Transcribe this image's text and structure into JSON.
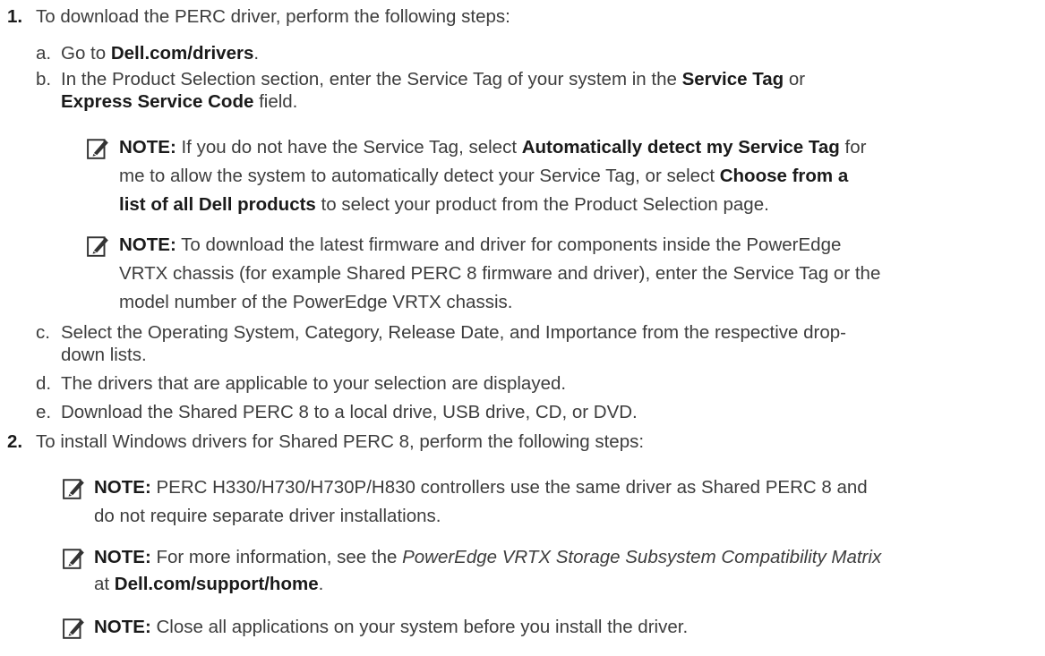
{
  "step1": {
    "number": "1.",
    "intro": "To download the PERC driver, perform the following steps:",
    "a": {
      "letter": "a.",
      "pre": "Go to ",
      "bold": "Dell.com/drivers",
      "post": "."
    },
    "b": {
      "letter": "b.",
      "line1_pre": "In the Product Selection section, enter the Service Tag of your system in the ",
      "line1_bold": "Service Tag",
      "line1_post": " or",
      "line2_bold": "Express Service Code",
      "line2_post": " field."
    },
    "note1": {
      "label": "NOTE:",
      "l1_pre": " If you do not have the Service Tag, select ",
      "l1_bold": "Automatically detect my Service Tag",
      "l1_post": " for",
      "l2_pre": "me to allow the system to automatically detect your Service Tag, or select ",
      "l2_bold": "Choose from a",
      "l3_bold": "list of all Dell products",
      "l3_post": " to select your product from the Product Selection page."
    },
    "note2": {
      "label": "NOTE:",
      "l1": " To download the latest firmware and driver for components inside the PowerEdge",
      "l2": "VRTX chassis (for example Shared PERC 8 firmware and driver), enter the Service Tag or the",
      "l3": "model number of the PowerEdge VRTX chassis."
    },
    "c": {
      "letter": "c.",
      "l1": "Select the Operating System, Category, Release Date, and Importance from the respective drop-",
      "l2": "down lists."
    },
    "d": {
      "letter": "d.",
      "text": "The drivers that are applicable to your selection are displayed."
    },
    "e": {
      "letter": "e.",
      "text": "Download the Shared PERC 8 to a local drive, USB drive, CD, or DVD."
    }
  },
  "step2": {
    "number": "2.",
    "intro": "To install Windows drivers for Shared PERC 8, perform the following steps:",
    "note1": {
      "label": "NOTE:",
      "l1": " PERC H330/H730/H730P/H830 controllers use the same driver as Shared PERC 8 and",
      "l2": "do not require separate driver installations."
    },
    "note2": {
      "label": "NOTE:",
      "l1_pre": " For more information, see the ",
      "l1_italic": "PowerEdge VRTX Storage Subsystem Compatibility Matrix",
      "l2_pre": "at ",
      "l2_bold": "Dell.com/support/home",
      "l2_post": "."
    },
    "note3": {
      "label": "NOTE:",
      "l1": " Close all applications on your system before you install the driver."
    }
  },
  "icons": {
    "note": "note-pencil-icon"
  }
}
